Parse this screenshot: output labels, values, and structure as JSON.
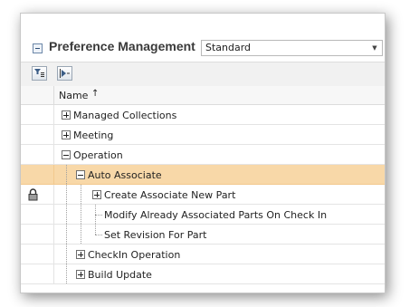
{
  "window": {
    "title": "Preference Management",
    "view_select": {
      "value": "Standard"
    }
  },
  "toolbar": {
    "buttons": [
      {
        "name": "filter",
        "icon": "filter-list-icon"
      },
      {
        "name": "expand",
        "icon": "expand-arrow-icon"
      }
    ]
  },
  "grid": {
    "column_name": "Name",
    "sort_indicator": "↑",
    "rows": [
      {
        "label": "Managed Collections",
        "level": 0,
        "expander": "plus"
      },
      {
        "label": "Meeting",
        "level": 0,
        "expander": "plus"
      },
      {
        "label": "Operation",
        "level": 0,
        "expander": "minus"
      },
      {
        "label": "Auto Associate",
        "level": 1,
        "expander": "minus",
        "selected": true
      },
      {
        "label": "Create Associate New Part",
        "level": 2,
        "expander": "plus",
        "locked": true
      },
      {
        "label": "Modify Already Associated Parts On Check In",
        "level": 2,
        "expander": "none"
      },
      {
        "label": "Set Revision For Part",
        "level": 2,
        "expander": "none"
      },
      {
        "label": "CheckIn Operation",
        "level": 1,
        "expander": "plus"
      },
      {
        "label": "Build Update",
        "level": 1,
        "expander": "plus"
      }
    ]
  },
  "colors": {
    "selection": "#f8d8a8",
    "title_text": "#3a3a3a"
  }
}
